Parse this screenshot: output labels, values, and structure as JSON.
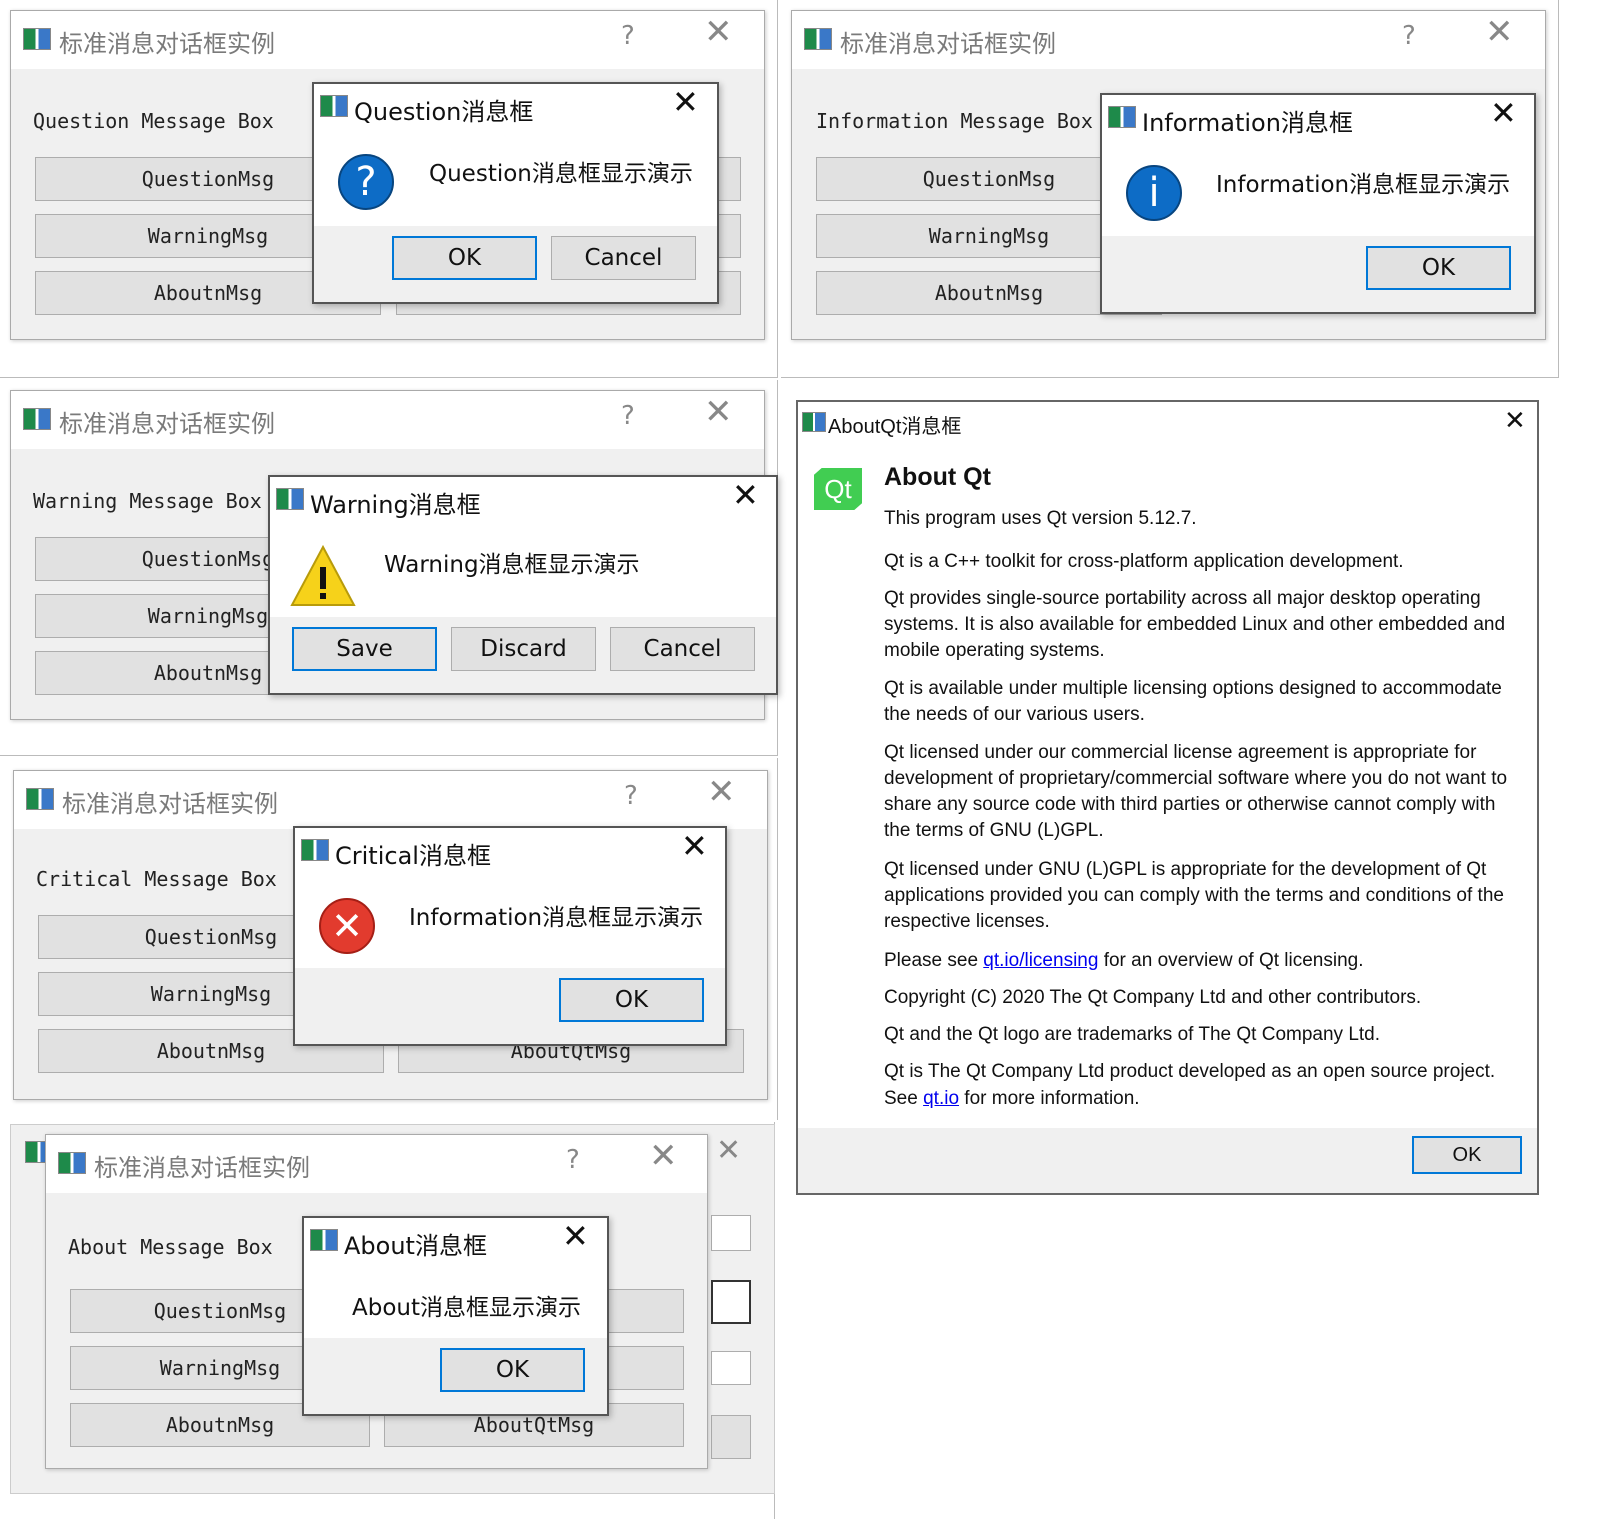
{
  "main_window": {
    "title": "标准消息对话框实例",
    "help_glyph": "?",
    "close_glyph": "✕",
    "buttons": {
      "question": "QuestionMsg",
      "warning": "WarningMsg",
      "about": "AboutnMsg",
      "about_qt": "AboutQtMsg"
    }
  },
  "panel_question": {
    "label": "Question Message Box",
    "dialog": {
      "title": "Question消息框",
      "text": "Question消息框显示演示",
      "icon": "question-icon",
      "buttons": [
        "OK",
        "Cancel"
      ]
    }
  },
  "panel_information": {
    "label": "Information Message Box",
    "dialog": {
      "title": "Information消息框",
      "text": "Information消息框显示演示",
      "icon": "information-icon",
      "buttons": [
        "OK"
      ]
    }
  },
  "panel_warning": {
    "label": "Warning Message Box",
    "dialog": {
      "title": "Warning消息框",
      "text": "Warning消息框显示演示",
      "icon": "warning-icon",
      "buttons": [
        "Save",
        "Discard",
        "Cancel"
      ]
    }
  },
  "panel_critical": {
    "label": "Critical Message Box",
    "dialog": {
      "title": "Critical消息框",
      "text": "Information消息框显示演示",
      "icon": "critical-icon",
      "buttons": [
        "OK"
      ]
    }
  },
  "panel_about": {
    "label": "About Message Box",
    "dialog": {
      "title": "About消息框",
      "text": "About消息框显示演示",
      "buttons": [
        "OK"
      ]
    }
  },
  "about_qt": {
    "title": "AboutQt消息框",
    "logo_text": "Qt",
    "heading": "About Qt",
    "version_line": "This program uses Qt version 5.12.7.",
    "p1": "Qt is a C++ toolkit for cross-platform application development.",
    "p2": "Qt provides single-source portability across all major desktop operating systems. It is also available for embedded Linux and other embedded and mobile operating systems.",
    "p3": "Qt is available under multiple licensing options designed to accommodate the needs of our various users.",
    "p4": "Qt licensed under our commercial license agreement is appropriate for development of proprietary/commercial software where you do not want to share any source code with third parties or otherwise cannot comply with the terms of GNU (L)GPL.",
    "p5": "Qt licensed under GNU (L)GPL is appropriate for the development of Qt applications provided you can comply with the terms and conditions of the respective licenses.",
    "p6_pre": "Please see ",
    "p6_link": "qt.io/licensing",
    "p6_post": " for an overview of Qt licensing.",
    "p7": "Copyright (C) 2020 The Qt Company Ltd and other contributors.",
    "p8": "Qt and the Qt logo are trademarks of The Qt Company Ltd.",
    "p9": "Qt is The Qt Company Ltd product developed as an open source project.",
    "p10_pre": "See ",
    "p10_link": "qt.io",
    "p10_post": " for more information.",
    "ok": "OK"
  },
  "colors": {
    "accent": "#0078d7",
    "qt_green": "#41cd52",
    "link": "#0000ee"
  }
}
